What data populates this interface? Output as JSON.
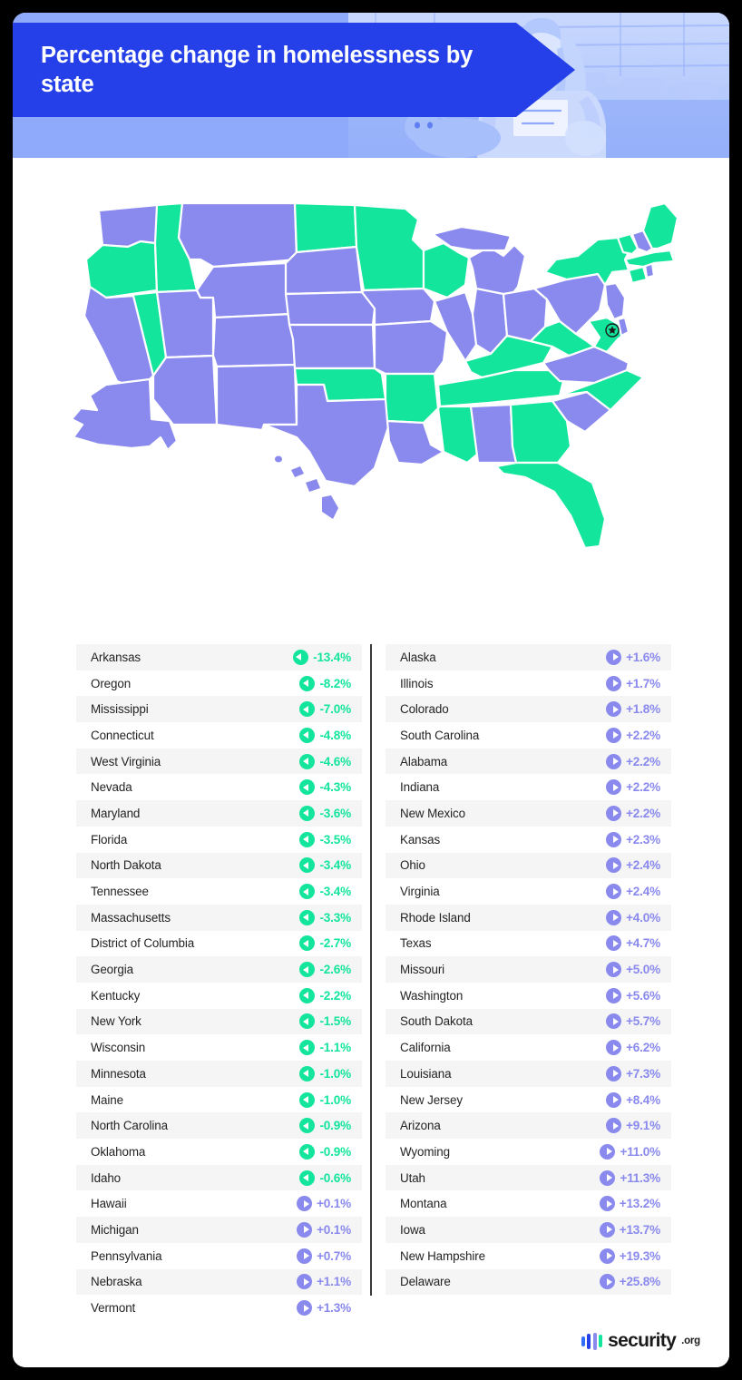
{
  "header": {
    "title": "Percentage change in homelessness by state",
    "banner_color": "#2540e8",
    "band_color": "#8fa9fb",
    "photo_alt": "person-with-sign-photo"
  },
  "colors": {
    "decrease": "#14e59c",
    "increase": "#8a8aee",
    "map_stroke": "#ffffff",
    "row_alt": "#f5f5f5",
    "text": "#232323"
  },
  "map": {
    "decrease_states": [
      "Oregon",
      "Idaho",
      "Nevada",
      "North Dakota",
      "Minnesota",
      "Wisconsin",
      "Oklahoma",
      "Arkansas",
      "Mississippi",
      "Tennessee",
      "Kentucky",
      "West Virginia",
      "Georgia",
      "Florida",
      "North Carolina",
      "Maryland",
      "New York",
      "Maine",
      "Vermont",
      "Massachusetts",
      "Connecticut",
      "District of Columbia"
    ],
    "increase_states": [
      "Washington",
      "California",
      "Arizona",
      "Utah",
      "Montana",
      "Wyoming",
      "Colorado",
      "New Mexico",
      "South Dakota",
      "Nebraska",
      "Kansas",
      "Texas",
      "Louisiana",
      "Iowa",
      "Missouri",
      "Illinois",
      "Indiana",
      "Michigan",
      "Ohio",
      "Pennsylvania",
      "Virginia",
      "South Carolina",
      "Alabama",
      "New Jersey",
      "Delaware",
      "Rhode Island",
      "New Hampshire",
      "Alaska",
      "Hawaii"
    ],
    "dc_marker": "star-marker"
  },
  "chart_data": {
    "type": "table",
    "title": "Percentage change in homelessness by state",
    "columns": [
      "State",
      "Percentage change"
    ],
    "left_column": [
      {
        "state": "Arkansas",
        "value": -13.4,
        "label": "-13.4%",
        "direction": "decrease"
      },
      {
        "state": "Oregon",
        "value": -8.2,
        "label": "-8.2%",
        "direction": "decrease"
      },
      {
        "state": "Mississippi",
        "value": -7.0,
        "label": "-7.0%",
        "direction": "decrease"
      },
      {
        "state": "Connecticut",
        "value": -4.8,
        "label": "-4.8%",
        "direction": "decrease"
      },
      {
        "state": "West Virginia",
        "value": -4.6,
        "label": "-4.6%",
        "direction": "decrease"
      },
      {
        "state": "Nevada",
        "value": -4.3,
        "label": "-4.3%",
        "direction": "decrease"
      },
      {
        "state": "Maryland",
        "value": -3.6,
        "label": "-3.6%",
        "direction": "decrease"
      },
      {
        "state": "Florida",
        "value": -3.5,
        "label": "-3.5%",
        "direction": "decrease"
      },
      {
        "state": "North Dakota",
        "value": -3.4,
        "label": "-3.4%",
        "direction": "decrease"
      },
      {
        "state": "Tennessee",
        "value": -3.4,
        "label": "-3.4%",
        "direction": "decrease"
      },
      {
        "state": "Massachusetts",
        "value": -3.3,
        "label": "-3.3%",
        "direction": "decrease"
      },
      {
        "state": "District of Columbia",
        "value": -2.7,
        "label": "-2.7%",
        "direction": "decrease"
      },
      {
        "state": "Georgia",
        "value": -2.6,
        "label": "-2.6%",
        "direction": "decrease"
      },
      {
        "state": "Kentucky",
        "value": -2.2,
        "label": "-2.2%",
        "direction": "decrease"
      },
      {
        "state": "New York",
        "value": -1.5,
        "label": "-1.5%",
        "direction": "decrease"
      },
      {
        "state": "Wisconsin",
        "value": -1.1,
        "label": "-1.1%",
        "direction": "decrease"
      },
      {
        "state": "Minnesota",
        "value": -1.0,
        "label": "-1.0%",
        "direction": "decrease"
      },
      {
        "state": "Maine",
        "value": -1.0,
        "label": "-1.0%",
        "direction": "decrease"
      },
      {
        "state": "North Carolina",
        "value": -0.9,
        "label": "-0.9%",
        "direction": "decrease"
      },
      {
        "state": "Oklahoma",
        "value": -0.9,
        "label": "-0.9%",
        "direction": "decrease"
      },
      {
        "state": "Idaho",
        "value": -0.6,
        "label": "-0.6%",
        "direction": "decrease"
      },
      {
        "state": "Hawaii",
        "value": 0.1,
        "label": "+0.1%",
        "direction": "increase"
      },
      {
        "state": "Michigan",
        "value": 0.1,
        "label": "+0.1%",
        "direction": "increase"
      },
      {
        "state": "Pennsylvania",
        "value": 0.7,
        "label": "+0.7%",
        "direction": "increase"
      },
      {
        "state": "Nebraska",
        "value": 1.1,
        "label": "+1.1%",
        "direction": "increase"
      },
      {
        "state": "Vermont",
        "value": 1.3,
        "label": "+1.3%",
        "direction": "increase"
      }
    ],
    "right_column": [
      {
        "state": "Alaska",
        "value": 1.6,
        "label": "+1.6%",
        "direction": "increase"
      },
      {
        "state": "Illinois",
        "value": 1.7,
        "label": "+1.7%",
        "direction": "increase"
      },
      {
        "state": "Colorado",
        "value": 1.8,
        "label": "+1.8%",
        "direction": "increase"
      },
      {
        "state": "South Carolina",
        "value": 2.2,
        "label": "+2.2%",
        "direction": "increase"
      },
      {
        "state": "Alabama",
        "value": 2.2,
        "label": "+2.2%",
        "direction": "increase"
      },
      {
        "state": "Indiana",
        "value": 2.2,
        "label": "+2.2%",
        "direction": "increase"
      },
      {
        "state": "New Mexico",
        "value": 2.2,
        "label": "+2.2%",
        "direction": "increase"
      },
      {
        "state": "Kansas",
        "value": 2.3,
        "label": "+2.3%",
        "direction": "increase"
      },
      {
        "state": "Ohio",
        "value": 2.4,
        "label": "+2.4%",
        "direction": "increase"
      },
      {
        "state": "Virginia",
        "value": 2.4,
        "label": "+2.4%",
        "direction": "increase"
      },
      {
        "state": "Rhode Island",
        "value": 4.0,
        "label": "+4.0%",
        "direction": "increase"
      },
      {
        "state": "Texas",
        "value": 4.7,
        "label": "+4.7%",
        "direction": "increase"
      },
      {
        "state": "Missouri",
        "value": 5.0,
        "label": "+5.0%",
        "direction": "increase"
      },
      {
        "state": "Washington",
        "value": 5.6,
        "label": "+5.6%",
        "direction": "increase"
      },
      {
        "state": "South Dakota",
        "value": 5.7,
        "label": "+5.7%",
        "direction": "increase"
      },
      {
        "state": "California",
        "value": 6.2,
        "label": "+6.2%",
        "direction": "increase"
      },
      {
        "state": "Louisiana",
        "value": 7.3,
        "label": "+7.3%",
        "direction": "increase"
      },
      {
        "state": "New Jersey",
        "value": 8.4,
        "label": "+8.4%",
        "direction": "increase"
      },
      {
        "state": "Arizona",
        "value": 9.1,
        "label": "+9.1%",
        "direction": "increase"
      },
      {
        "state": "Wyoming",
        "value": 11.0,
        "label": "+11.0%",
        "direction": "increase"
      },
      {
        "state": "Utah",
        "value": 11.3,
        "label": "+11.3%",
        "direction": "increase"
      },
      {
        "state": "Montana",
        "value": 13.2,
        "label": "+13.2%",
        "direction": "increase"
      },
      {
        "state": "Iowa",
        "value": 13.7,
        "label": "+13.7%",
        "direction": "increase"
      },
      {
        "state": "New Hampshire",
        "value": 19.3,
        "label": "+19.3%",
        "direction": "increase"
      },
      {
        "state": "Delaware",
        "value": 25.8,
        "label": "+25.8%",
        "direction": "increase"
      }
    ]
  },
  "footer": {
    "logo_name": "security",
    "logo_tld": ".org",
    "logo_bar_colors": [
      "#2f6dfb",
      "#2540e8",
      "#8a8aee",
      "#14e59c"
    ]
  }
}
